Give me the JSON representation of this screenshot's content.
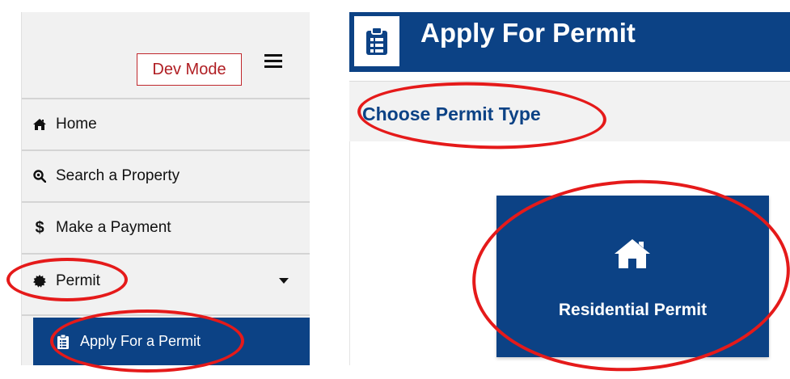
{
  "sidebar": {
    "dev_mode_label": "Dev Mode",
    "items": [
      {
        "label": "Home",
        "icon": "home-icon"
      },
      {
        "label": "Search a Property",
        "icon": "search-icon"
      },
      {
        "label": "Make a Payment",
        "icon": "dollar-icon"
      },
      {
        "label": "Permit",
        "icon": "badge-icon"
      }
    ],
    "submenu": {
      "label": "Apply For a Permit",
      "icon": "clipboard-icon"
    }
  },
  "header": {
    "title": "Apply For Permit",
    "icon": "clipboard-icon"
  },
  "section": {
    "title": "Choose Permit Type"
  },
  "permit_card": {
    "label": "Residential Permit",
    "icon": "home-icon"
  },
  "colors": {
    "primary": "#0c4285",
    "dev_mode": "#b01e23",
    "annotation": "#e51a1a",
    "sidebar_bg": "#f1f1f1"
  }
}
